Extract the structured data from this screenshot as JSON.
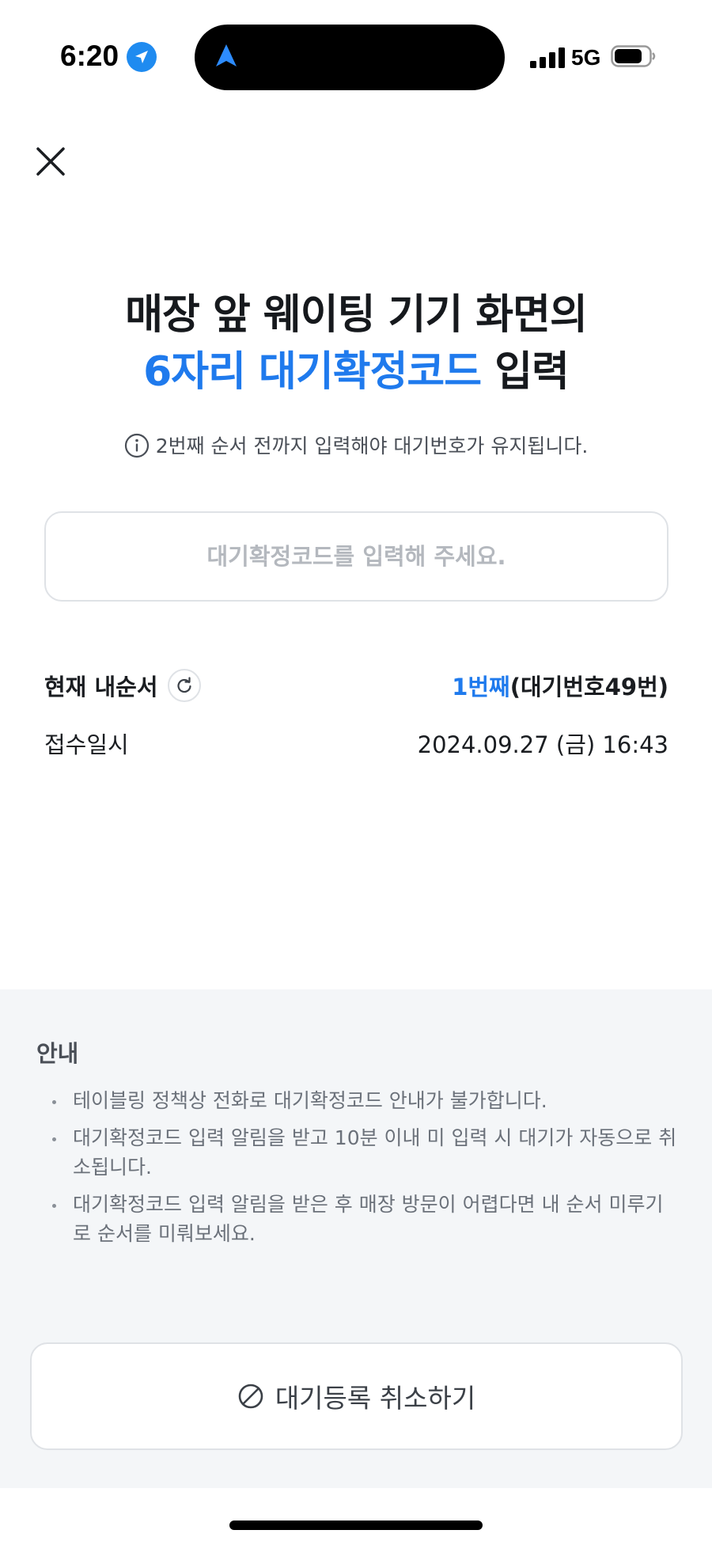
{
  "status_bar": {
    "time": "6:20",
    "network": "5G",
    "icons": [
      "location-arrow-icon",
      "navigation-icon",
      "signal-icon",
      "battery-icon"
    ]
  },
  "header": {
    "close_icon": "close-icon"
  },
  "title": {
    "line1": "매장 앞 웨이팅 기기 화면의",
    "line2_accent": "6자리 대기확정코드",
    "line2_rest": " 입력"
  },
  "notice": {
    "icon": "info-icon",
    "text": "2번째 순서 전까지 입력해야 대기번호가 유지됩니다."
  },
  "code_input": {
    "placeholder": "대기확정코드를 입력해 주세요.",
    "value": ""
  },
  "status": {
    "order_label": "현재 내순서",
    "order_accent": "1번째",
    "order_rest": "(대기번호49번)",
    "received_label": "접수일시",
    "received_value": "2024.09.27 (금) 16:43"
  },
  "guide": {
    "title": "안내",
    "items": [
      "테이블링 정책상 전화로 대기확정코드 안내가 불가합니다.",
      "대기확정코드 입력 알림을 받고 10분 이내 미 입력 시 대기가 자동으로 취소됩니다.",
      "대기확정코드 입력 알림을 받은 후 매장 방문이 어렵다면 내 순서 미루기로 순서를 미뤄보세요."
    ]
  },
  "cancel_button": {
    "label": "대기등록 취소하기",
    "icon": "prohibit-icon"
  },
  "colors": {
    "accent": "#1f7aed",
    "bottom_bg": "#f4f6f8",
    "border": "#dfe2e6"
  }
}
